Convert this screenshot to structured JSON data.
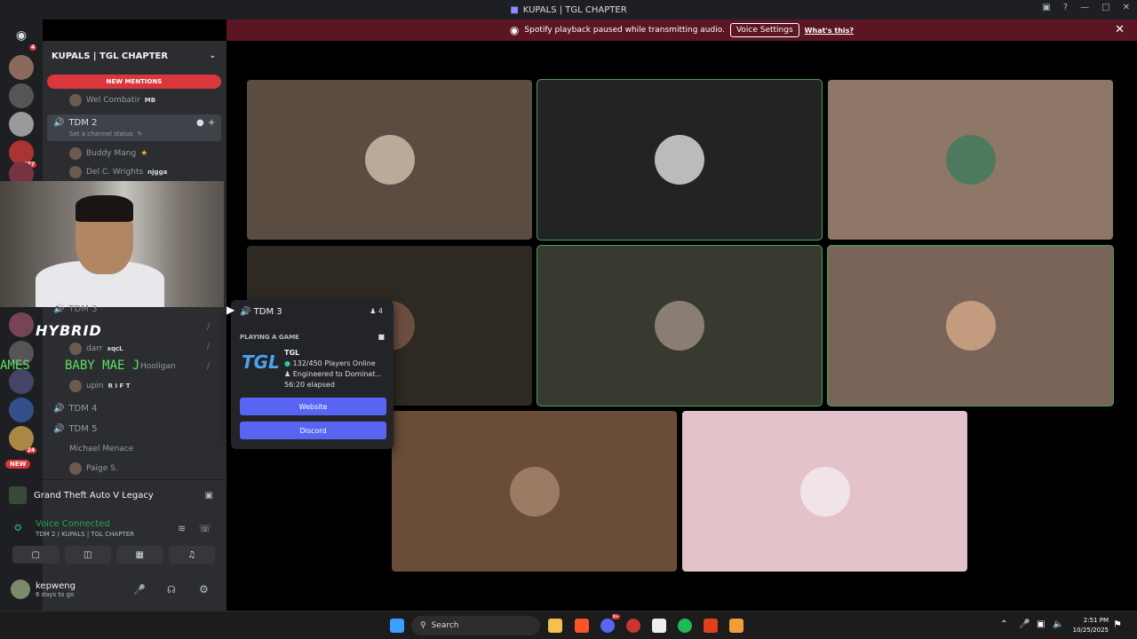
{
  "window": {
    "title": "KUPALS | TGL CHAPTER"
  },
  "banner": {
    "message": "Spotify playback paused while transmitting audio.",
    "voice_settings": "Voice Settings",
    "whats_this": "What's this?"
  },
  "servers": {
    "badges": [
      "4",
      "677",
      "24",
      "NEW"
    ]
  },
  "sidebar": {
    "server_name": "KUPALS | TGL CHAPTER",
    "new_mentions": "NEW MENTIONS",
    "items": [
      {
        "name": "Wel Combatir",
        "tag": "MB"
      },
      {
        "name": "TDM 2",
        "status": "Set a channel status"
      },
      {
        "name": "Buddy Mang"
      },
      {
        "name": "Del C. Wrights",
        "tag": "njgga"
      },
      {
        "name": "TDM 3"
      },
      {
        "name": "darr",
        "tag": "xqcL"
      },
      {
        "name": "Hooligan"
      },
      {
        "name": "upin",
        "tag": "R I F T"
      },
      {
        "name": "TDM 4"
      },
      {
        "name": "TDM 5"
      },
      {
        "name": "Michael Menace"
      },
      {
        "name": "Paige S."
      }
    ],
    "overlay_hybrid": "HYBRID",
    "overlay_ames": "AMES",
    "overlay_baby": "BABY MAE J",
    "game": "Grand Theft Auto V Legacy",
    "voice_connected": "Voice Connected",
    "voice_channel": "TDM 2 / KUPALS | TGL CHAPTER",
    "user": {
      "name": "kepweng",
      "status": "6 days to go"
    }
  },
  "popup": {
    "channel": "TDM 3",
    "count": "4",
    "playing": "PLAYING A GAME",
    "game": "TGL",
    "players": "132/450 Players Online",
    "desc": "Engineered to Dominat...",
    "elapsed": "56:20 elapsed",
    "website": "Website",
    "discord": "Discord"
  },
  "taskbar": {
    "search": "Search",
    "time": "2:51 PM",
    "date": "10/25/2025",
    "discord_badge": "9+"
  },
  "colors": {
    "accent": "#5865f2",
    "speaking": "#3ba55c",
    "danger": "#da373c"
  }
}
